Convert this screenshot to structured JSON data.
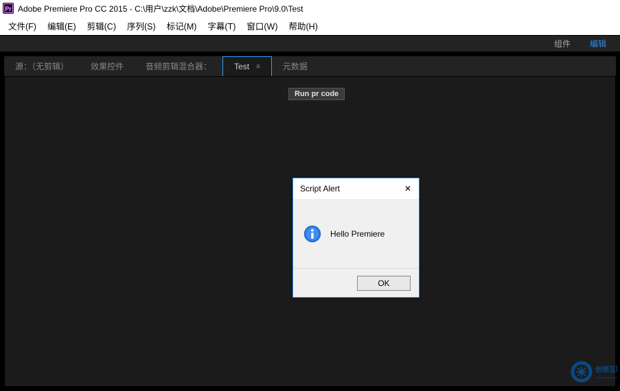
{
  "title": "Adobe Premiere Pro CC 2015 - C:\\用户\\zzk\\文档\\Adobe\\Premiere Pro\\9.0\\Test",
  "menu": {
    "file": "文件(F)",
    "edit": "编辑(E)",
    "clip": "剪辑(C)",
    "sequence": "序列(S)",
    "marker": "标记(M)",
    "title": "字幕(T)",
    "window": "窗口(W)",
    "help": "帮助(H)"
  },
  "topbar": {
    "components": "组件",
    "edit": "编辑"
  },
  "tabs": {
    "source": "源：（无剪辑）",
    "effects": "效果控件",
    "mixer": "音频剪辑混合器：",
    "test": "Test",
    "hamb": "≡",
    "metadata": "元数据"
  },
  "panel": {
    "run_button": "Run pr code"
  },
  "dialog": {
    "title": "Script Alert",
    "close": "✕",
    "message": "Hello Premiere",
    "ok": "OK"
  },
  "watermark": {
    "big": "创想互联",
    "small": "CHUANGXIANG HULIAN"
  }
}
